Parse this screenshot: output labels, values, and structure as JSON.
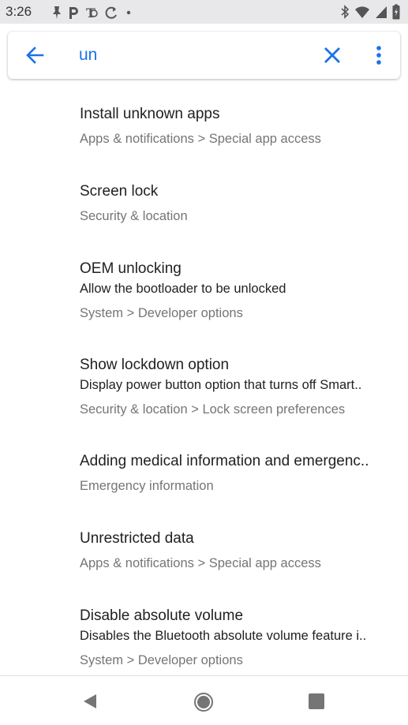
{
  "status_bar": {
    "time": "3:26",
    "left_icons": [
      "notification-icon",
      "parking-icon",
      "nyt-icon",
      "sync-icon",
      "dot-icon"
    ],
    "right_icons": [
      "bluetooth-icon",
      "wifi-icon",
      "signal-icon",
      "battery-icon"
    ]
  },
  "search": {
    "query": "un",
    "back_icon": "arrow-back-icon",
    "clear_icon": "close-icon",
    "more_icon": "more-vert-icon",
    "accent_color": "#1a73e8"
  },
  "results": [
    {
      "title": "Install unknown apps",
      "summary": "",
      "path": "Apps & notifications > Special app access"
    },
    {
      "title": "Screen lock",
      "summary": "",
      "path": "Security & location"
    },
    {
      "title": "OEM unlocking",
      "summary": "Allow the bootloader to be unlocked",
      "path": "System > Developer options"
    },
    {
      "title": "Show lockdown option",
      "summary": "Display power button option that turns off Smart..",
      "path": "Security & location > Lock screen preferences"
    },
    {
      "title": "Adding medical information and emergenc..",
      "summary": "",
      "path": "Emergency information"
    },
    {
      "title": "Unrestricted data",
      "summary": "",
      "path": "Apps & notifications > Special app access"
    },
    {
      "title": "Disable absolute volume",
      "summary": "Disables the Bluetooth absolute volume feature i..",
      "path": "System > Developer options"
    }
  ],
  "nav_bar": {
    "back_icon": "nav-back-icon",
    "home_icon": "nav-home-icon",
    "recents_icon": "nav-recents-icon"
  }
}
